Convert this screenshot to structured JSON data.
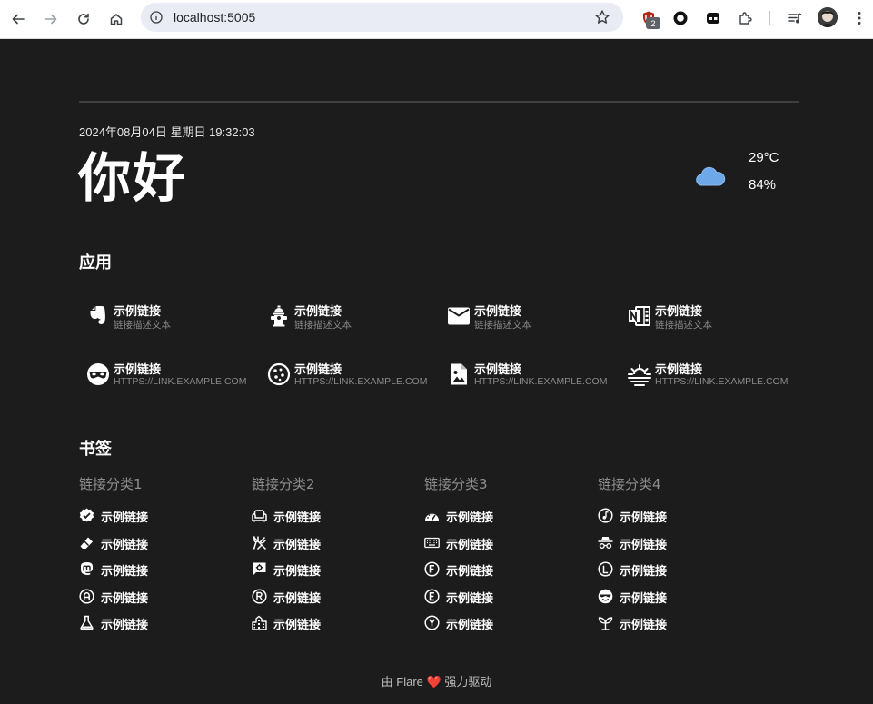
{
  "browser": {
    "url": "localhost:5005",
    "extension_badge": "2"
  },
  "page": {
    "datetime": "2024年08月04日 星期日 19:32:03",
    "greeting": "你好",
    "weather": {
      "icon": "cloud-icon",
      "temperature": "29°C",
      "humidity": "84%"
    },
    "apps_title": "应用",
    "apps": [
      {
        "icon": "evernote-icon",
        "title": "示例链接",
        "desc": "链接描述文本"
      },
      {
        "icon": "fire-hydrant-icon",
        "title": "示例链接",
        "desc": "链接描述文本"
      },
      {
        "icon": "email-icon",
        "title": "示例链接",
        "desc": "链接描述文本"
      },
      {
        "icon": "onenote-icon",
        "title": "示例链接",
        "desc": "链接描述文本"
      },
      {
        "icon": "domino-mask-icon",
        "title": "示例链接",
        "desc": "HTTPS://LINK.EXAMPLE.COM"
      },
      {
        "icon": "cookie-icon",
        "title": "示例链接",
        "desc": "HTTPS://LINK.EXAMPLE.COM"
      },
      {
        "icon": "file-image-icon",
        "title": "示例链接",
        "desc": "HTTPS://LINK.EXAMPLE.COM"
      },
      {
        "icon": "weather-sunset-icon",
        "title": "示例链接",
        "desc": "HTTPS://LINK.EXAMPLE.COM"
      }
    ],
    "bookmarks_title": "书签",
    "categories": [
      {
        "title": "链接分类1",
        "items": [
          {
            "icon": "check-decagram-icon",
            "label": "示例链接"
          },
          {
            "icon": "eraser-icon",
            "label": "示例链接"
          },
          {
            "icon": "mastodon-icon",
            "label": "示例链接"
          },
          {
            "icon": "alpha-a-circle-icon",
            "label": "示例链接"
          },
          {
            "icon": "flask-icon",
            "label": "示例链接"
          }
        ]
      },
      {
        "title": "链接分类2",
        "items": [
          {
            "icon": "sofa-icon",
            "label": "示例链接"
          },
          {
            "icon": "silverware-off-icon",
            "label": "示例链接"
          },
          {
            "icon": "message-cog-icon",
            "label": "示例链接"
          },
          {
            "icon": "alpha-r-circle-icon",
            "label": "示例链接"
          },
          {
            "icon": "city-icon",
            "label": "示例链接"
          }
        ]
      },
      {
        "title": "链接分类3",
        "items": [
          {
            "icon": "speedometer-icon",
            "label": "示例链接"
          },
          {
            "icon": "keyboard-icon",
            "label": "示例链接"
          },
          {
            "icon": "alpha-f-circle-icon",
            "label": "示例链接"
          },
          {
            "icon": "alpha-e-circle-icon",
            "label": "示例链接"
          },
          {
            "icon": "alpha-y-circle-icon",
            "label": "示例链接"
          }
        ]
      },
      {
        "title": "链接分类4",
        "items": [
          {
            "icon": "music-note-circle-icon",
            "label": "示例链接"
          },
          {
            "icon": "incognito-icon",
            "label": "示例链接"
          },
          {
            "icon": "alpha-l-circle-icon",
            "label": "示例链接"
          },
          {
            "icon": "emoticon-cool-icon",
            "label": "示例链接"
          },
          {
            "icon": "sprout-icon",
            "label": "示例链接"
          }
        ]
      }
    ],
    "footer": {
      "prefix": "由 Flare",
      "heart": "❤️",
      "suffix": "强力驱动"
    }
  },
  "colors": {
    "background": "#1c1c1d",
    "text": "#ffffff",
    "muted": "#8a8a8a",
    "weather_cloud": "#6fa8e8"
  }
}
